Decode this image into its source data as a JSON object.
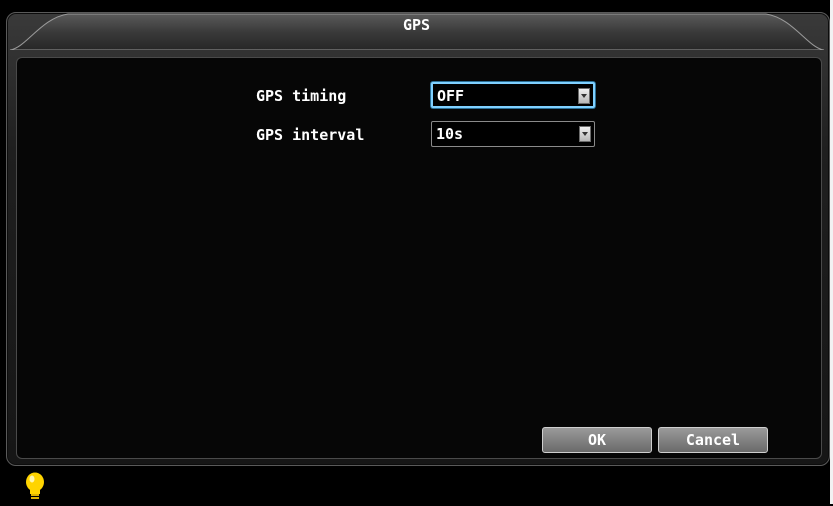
{
  "dialog": {
    "title": "GPS"
  },
  "form": {
    "gps_timing": {
      "label": "GPS timing",
      "value": "OFF"
    },
    "gps_interval": {
      "label": "GPS interval",
      "value": "10s"
    }
  },
  "buttons": {
    "ok_label": "OK",
    "cancel_label": "Cancel"
  },
  "status": {
    "icon": "lightbulb-icon",
    "icon_color": "#ffd400"
  },
  "colors": {
    "focus_border": "#7fd0ff",
    "background": "#000000"
  }
}
